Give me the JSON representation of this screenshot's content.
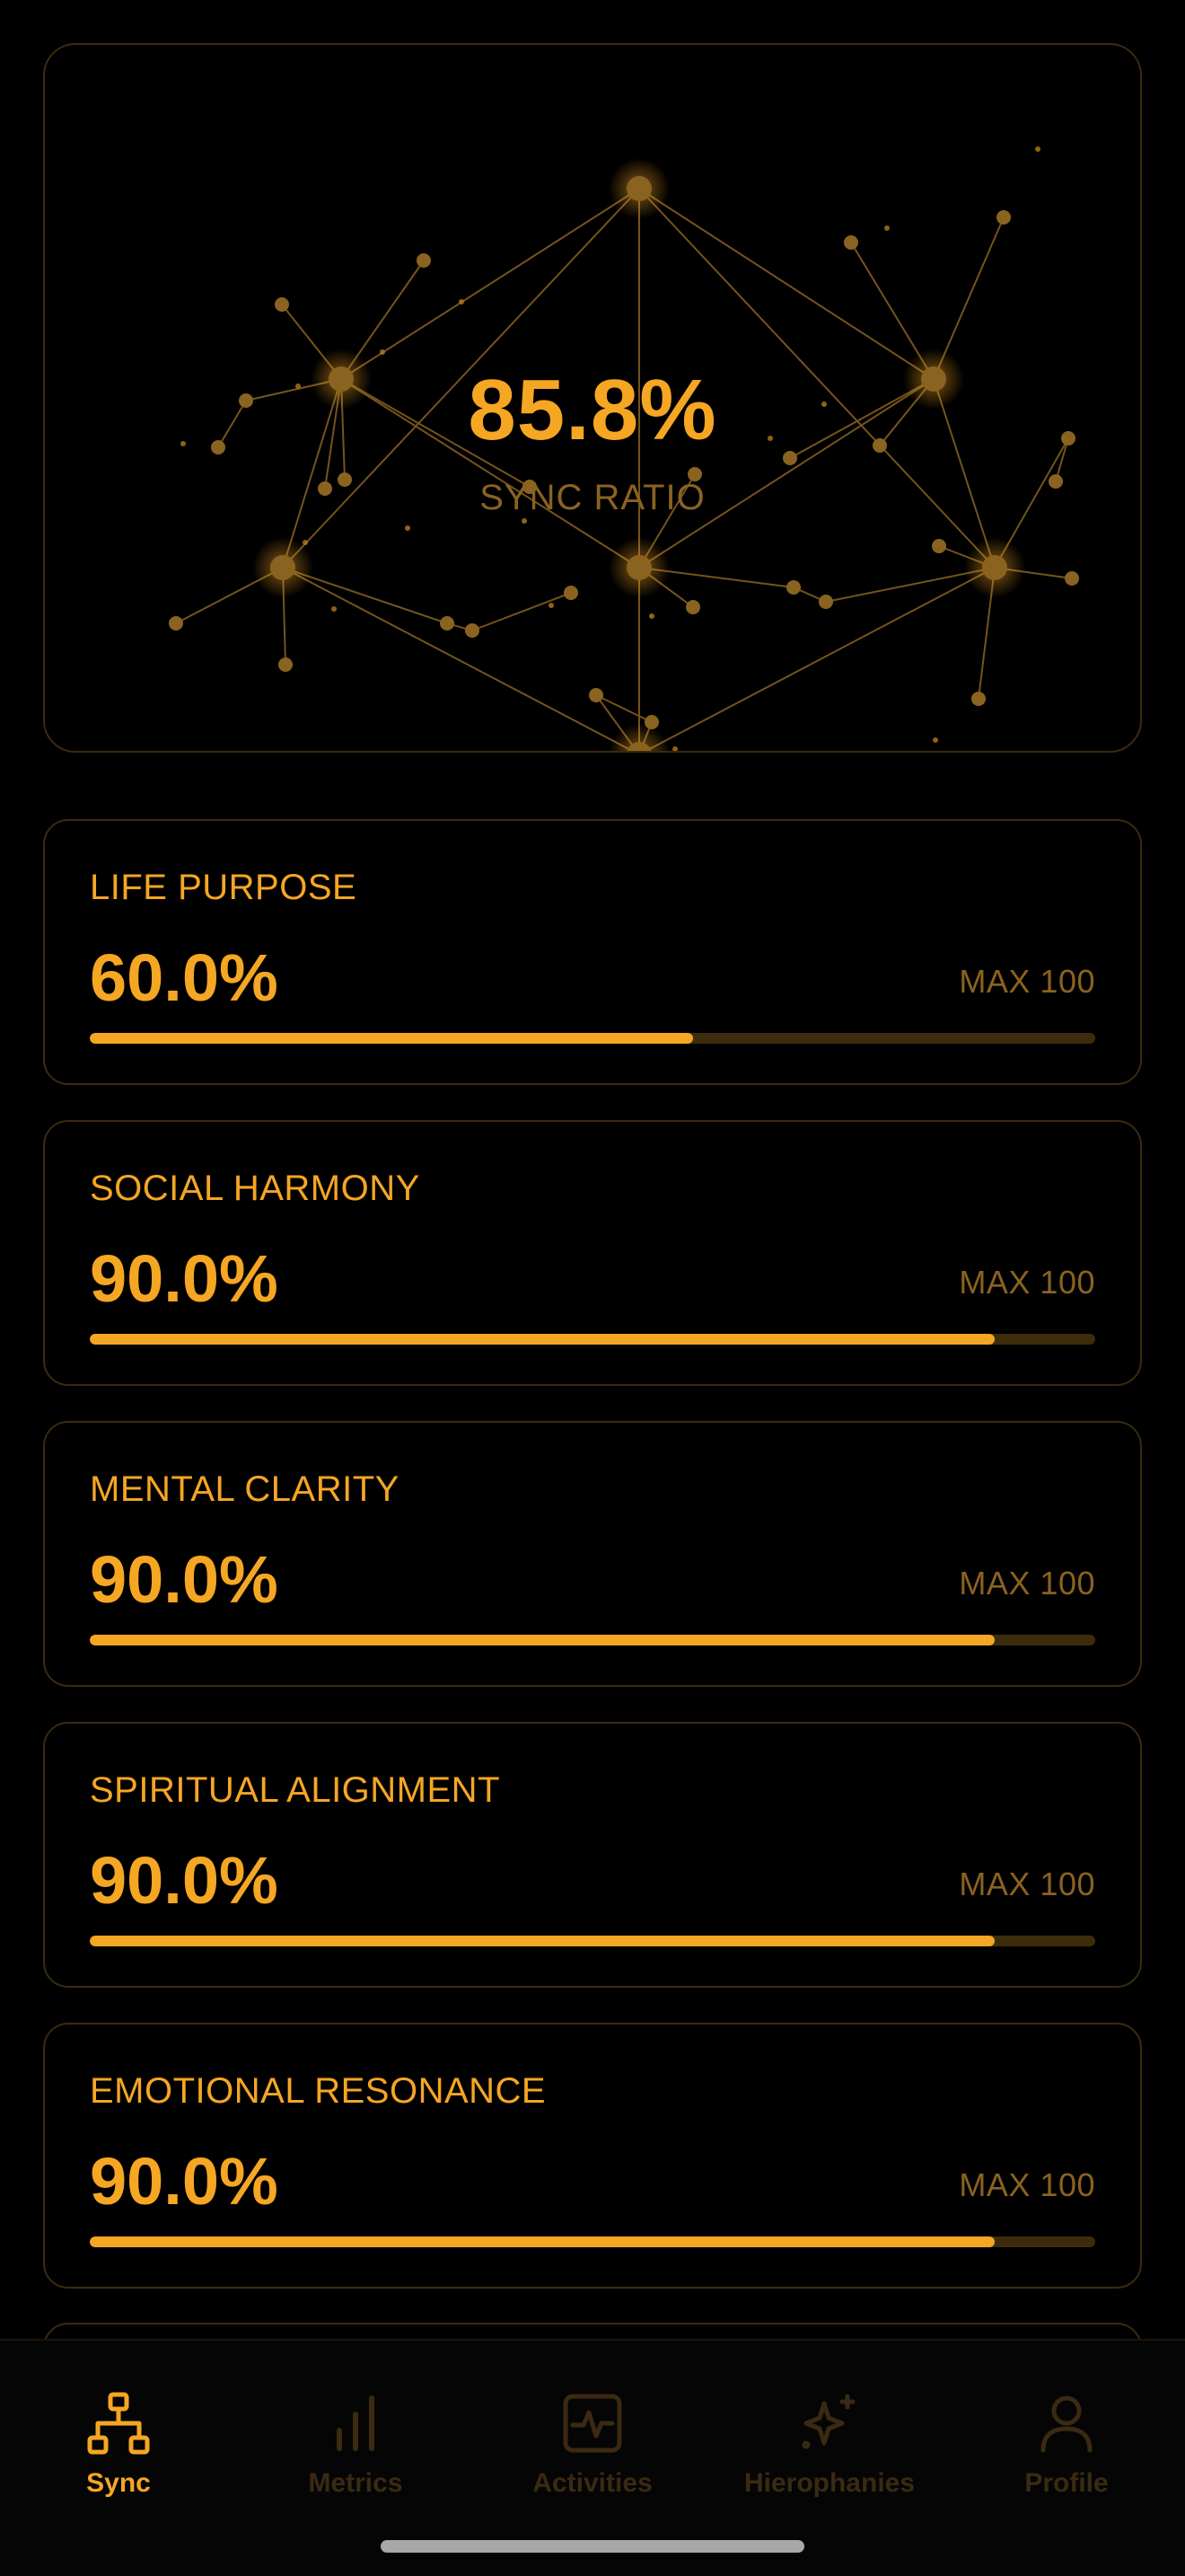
{
  "sync": {
    "value": "85.8%",
    "label": "SYNC RATIO"
  },
  "metrics": [
    {
      "title": "LIFE PURPOSE",
      "value": "60.0%",
      "max": "MAX 100",
      "progress": 0.6
    },
    {
      "title": "SOCIAL HARMONY",
      "value": "90.0%",
      "max": "MAX 100",
      "progress": 0.9
    },
    {
      "title": "MENTAL CLARITY",
      "value": "90.0%",
      "max": "MAX 100",
      "progress": 0.9
    },
    {
      "title": "SPIRITUAL ALIGNMENT",
      "value": "90.0%",
      "max": "MAX 100",
      "progress": 0.9
    },
    {
      "title": "EMOTIONAL RESONANCE",
      "value": "90.0%",
      "max": "MAX 100",
      "progress": 0.9
    }
  ],
  "tabs": [
    {
      "label": "Sync",
      "icon": "network-icon",
      "active": true
    },
    {
      "label": "Metrics",
      "icon": "bar-chart-icon",
      "active": false
    },
    {
      "label": "Activities",
      "icon": "activity-pulse-icon",
      "active": false
    },
    {
      "label": "Hierophanies",
      "icon": "sparkle-icon",
      "active": false
    },
    {
      "label": "Profile",
      "icon": "person-icon",
      "active": false
    }
  ],
  "colors": {
    "accent": "#f5a623",
    "muted": "#8a6320",
    "track": "#3d2c0c",
    "border": "#3a2a10",
    "inactive_tab": "#3a2a12",
    "background": "#000000"
  }
}
